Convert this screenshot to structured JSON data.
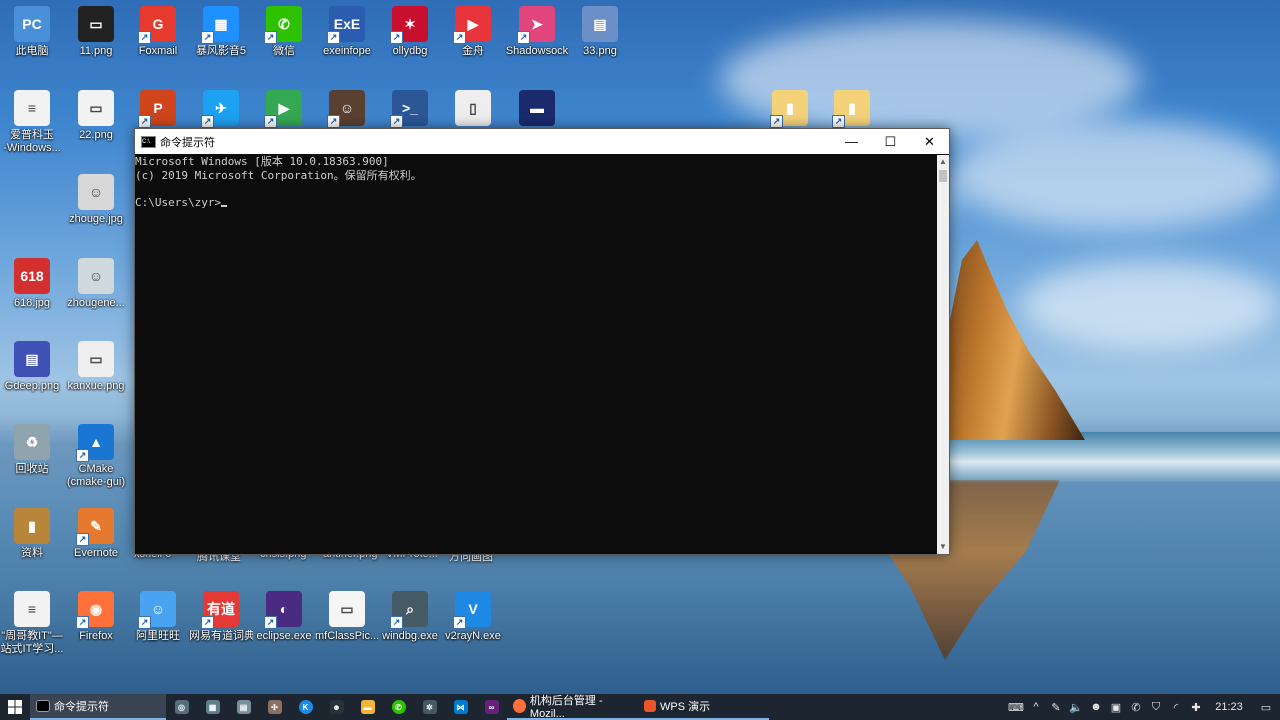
{
  "desktop": {
    "icons": [
      {
        "label": "此电脑",
        "glyph": "PC",
        "color": "#4a90d9",
        "shortcut": false
      },
      {
        "label": "11.png",
        "glyph": "▭",
        "color": "#222222",
        "shortcut": false
      },
      {
        "label": "Foxmail",
        "glyph": "G",
        "color": "#e63a2e",
        "shortcut": true
      },
      {
        "label": "暴风影音5",
        "glyph": "▦",
        "color": "#1e90ff",
        "shortcut": true
      },
      {
        "label": "微信",
        "glyph": "✆",
        "color": "#2dc100",
        "shortcut": true
      },
      {
        "label": "exeinfope",
        "glyph": "ExE",
        "color": "#2a5db0",
        "shortcut": true
      },
      {
        "label": "ollydbg",
        "glyph": "✶",
        "color": "#c8102e",
        "shortcut": true
      },
      {
        "label": "金舟",
        "glyph": "▶",
        "color": "#e8353b",
        "shortcut": true
      },
      {
        "label": "Shadowsock",
        "glyph": "➤",
        "color": "#e0457b",
        "shortcut": true
      },
      {
        "label": "33.png",
        "glyph": "▤",
        "color": "#6d8fc7",
        "shortcut": false
      },
      {
        "label": "爱普科玉\n-Windows...",
        "glyph": "≡",
        "color": "#f2f2f2",
        "shortcut": false
      },
      {
        "label": "22.png",
        "glyph": "▭",
        "color": "#f2f2f2",
        "shortcut": false
      },
      {
        "label": "",
        "glyph": "P",
        "color": "#d0451b",
        "shortcut": true
      },
      {
        "label": "",
        "glyph": "✈",
        "color": "#1da1f2",
        "shortcut": true
      },
      {
        "label": "",
        "glyph": "▶",
        "color": "#34a853",
        "shortcut": true
      },
      {
        "label": "",
        "glyph": "☺",
        "color": "#5a4030",
        "shortcut": true
      },
      {
        "label": "",
        "glyph": ">_",
        "color": "#2b5797",
        "shortcut": true
      },
      {
        "label": "",
        "glyph": "▯",
        "color": "#eeeeee",
        "shortcut": false
      },
      {
        "label": "",
        "glyph": "▬",
        "color": "#1a2a6c",
        "shortcut": false
      },
      {
        "label": "",
        "glyph": "▮",
        "color": "#f3d27a",
        "shortcut": true
      },
      {
        "label": "",
        "glyph": "▮",
        "color": "#f3d27a",
        "shortcut": true
      },
      {
        "label": "zhouge.jpg",
        "glyph": "☺",
        "color": "#d7d7d7",
        "shortcut": false
      },
      {
        "label": "618.jpg",
        "glyph": "618",
        "color": "#d32f2f",
        "shortcut": false
      },
      {
        "label": "zhougene...",
        "glyph": "☺",
        "color": "#cfd8dc",
        "shortcut": false
      },
      {
        "label": "Gdeep.png",
        "glyph": "▤",
        "color": "#3f51b5",
        "shortcut": false
      },
      {
        "label": "kanxue.png",
        "glyph": "▭",
        "color": "#eeeeee",
        "shortcut": false
      },
      {
        "label": "回收站",
        "glyph": "♻",
        "color": "#90a4ae",
        "shortcut": false
      },
      {
        "label": "CMake\n(cmake-gui)",
        "glyph": "▲",
        "color": "#1976d2",
        "shortcut": true
      },
      {
        "label": "资料",
        "glyph": "▮",
        "color": "#b8863b",
        "shortcut": false
      },
      {
        "label": "Evernote",
        "glyph": "✎",
        "color": "#e57a2e",
        "shortcut": true
      },
      {
        "label": "\"周哥教IT\"—\n站式IT学习...",
        "glyph": "≡",
        "color": "#f2f2f2",
        "shortcut": false
      },
      {
        "label": "Firefox",
        "glyph": "◉",
        "color": "#ff7139",
        "shortcut": true
      },
      {
        "label": "阿里旺旺",
        "glyph": "☺",
        "color": "#4aa3f0",
        "shortcut": true
      },
      {
        "label": "网易有道词典",
        "glyph": "有道",
        "color": "#e53935",
        "shortcut": true
      },
      {
        "label": "eclipse.exe",
        "glyph": "◐",
        "color": "#4b2a82",
        "shortcut": true
      },
      {
        "label": "mfClassPic...",
        "glyph": "▭",
        "color": "#f5f5f5",
        "shortcut": false
      },
      {
        "label": "windbg.exe",
        "glyph": "⌕",
        "color": "#455a64",
        "shortcut": true
      },
      {
        "label": "v2rayN.exe",
        "glyph": "V",
        "color": "#1e88e5",
        "shortcut": true
      }
    ],
    "partial_labels": [
      "xshell 6",
      "腾讯课堂",
      "crisis.png",
      "antiher.png",
      "VMProte...",
      "方向画图"
    ]
  },
  "cmd_window": {
    "title": "命令提示符",
    "icon_text": "C:\\",
    "minimize": "—",
    "maximize": "☐",
    "close": "✕",
    "lines": [
      "Microsoft Windows [版本 10.0.18363.900]",
      "(c) 2019 Microsoft Corporation。保留所有权利。",
      "",
      "C:\\Users\\zyr>"
    ]
  },
  "taskbar": {
    "tasks": [
      {
        "label": "命令提示符",
        "icon": "cmd-icon",
        "state": "active"
      },
      {
        "label": "机构后台管理 - Mozil...",
        "icon": "firefox-icon",
        "state": "open"
      },
      {
        "label": "WPS 演示",
        "icon": "wps-icon",
        "state": "open"
      }
    ],
    "clock": "21:23"
  }
}
